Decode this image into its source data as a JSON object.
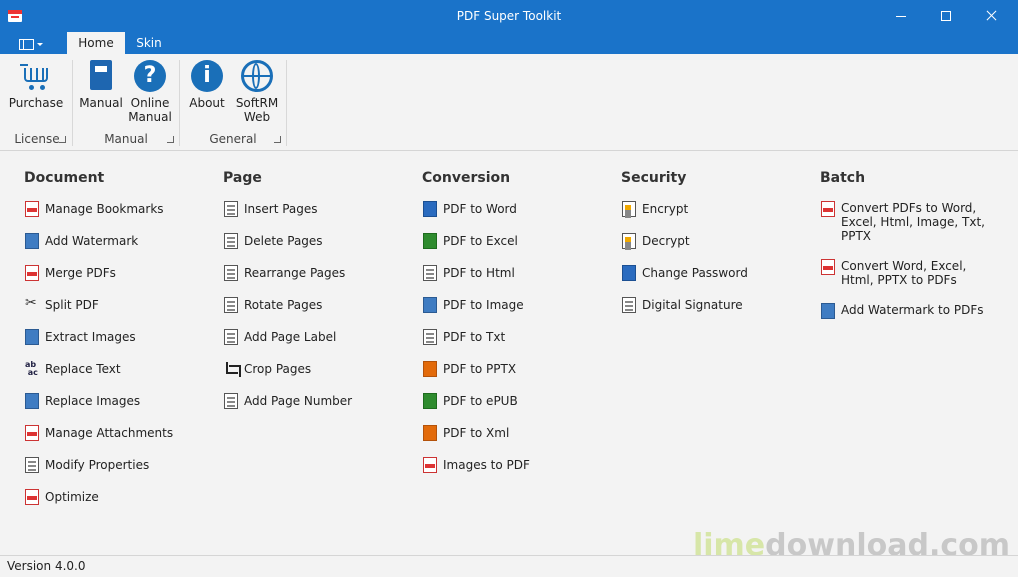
{
  "window": {
    "title": "PDF Super Toolkit"
  },
  "tabs": [
    {
      "label": "Home",
      "active": true
    },
    {
      "label": "Skin",
      "active": false
    }
  ],
  "ribbon": {
    "groups": [
      {
        "label": "License",
        "buttons": [
          {
            "label": "Purchase",
            "icon": "cart-icon"
          }
        ]
      },
      {
        "label": "Manual",
        "buttons": [
          {
            "label": "Manual",
            "icon": "book-icon"
          },
          {
            "label": "Online Manual",
            "line1": "Online",
            "line2": "Manual",
            "icon": "help-icon"
          }
        ]
      },
      {
        "label": "General",
        "buttons": [
          {
            "label": "About",
            "icon": "info-icon"
          },
          {
            "label": "SoftRM Web",
            "line1": "SoftRM",
            "line2": "Web",
            "icon": "globe-icon"
          }
        ]
      }
    ]
  },
  "sections": [
    {
      "title": "Document",
      "items": [
        "Manage Bookmarks",
        "Add Watermark",
        "Merge PDFs",
        "Split PDF",
        "Extract Images",
        "Replace Text",
        "Replace Images",
        "Manage Attachments",
        "Modify Properties",
        "Optimize"
      ]
    },
    {
      "title": "Page",
      "items": [
        "Insert Pages",
        "Delete Pages",
        "Rearrange Pages",
        "Rotate Pages",
        "Add Page Label",
        "Crop Pages",
        "Add Page Number"
      ]
    },
    {
      "title": "Conversion",
      "items": [
        "PDF to Word",
        "PDF to Excel",
        "PDF to Html",
        "PDF to Image",
        "PDF to Txt",
        "PDF to PPTX",
        "PDF to ePUB",
        "PDF to Xml",
        "Images to PDF"
      ]
    },
    {
      "title": "Security",
      "items": [
        "Encrypt",
        "Decrypt",
        "Change Password",
        "Digital Signature"
      ]
    },
    {
      "title": "Batch",
      "items": [
        "Convert PDFs to Word, Excel, Html, Image, Txt, PPTX",
        "Convert Word, Excel, Html, PPTX to PDFs",
        "Add Watermark to PDFs"
      ]
    }
  ],
  "status": {
    "version": "Version 4.0.0"
  },
  "watermark": {
    "part1": "lime",
    "part2": "download.com"
  },
  "colors": {
    "accent": "#1a73c9"
  }
}
